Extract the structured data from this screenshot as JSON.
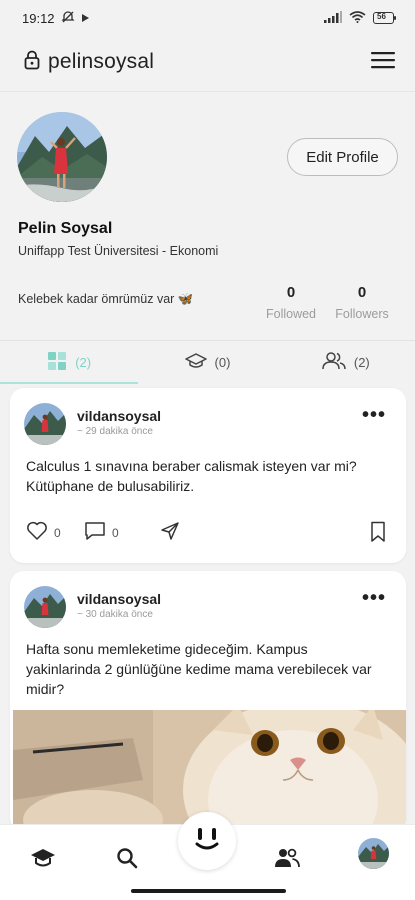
{
  "status_bar": {
    "time": "19:12",
    "battery": "56"
  },
  "header": {
    "username": "pelinsoysal"
  },
  "profile": {
    "edit_label": "Edit Profile",
    "name": "Pelin Soysal",
    "school": "Uniffapp Test Üniversitesi - Ekonomi",
    "bio": "Kelebek kadar ömrümüz var 🦋",
    "followed_count": "0",
    "followed_label": "Followed",
    "followers_count": "0",
    "followers_label": "Followers"
  },
  "tabs": [
    {
      "icon": "grid-icon",
      "count": "(2)",
      "active": true
    },
    {
      "icon": "graduation-cap-icon",
      "count": "(0)"
    },
    {
      "icon": "users-icon",
      "count": "(2)"
    }
  ],
  "posts": [
    {
      "user": "vildansoysal",
      "time": "~ 29 dakika önce",
      "text": "Calculus 1 sınavına beraber calismak isteyen var mi? Kütüphane de bulusabiliriz.",
      "likes": "0",
      "comments": "0"
    },
    {
      "user": "vildansoysal",
      "time": "~ 30 dakika önce",
      "text": "Hafta sonu memleketime gideceğim. Kampus yakinlarinda 2 günlüğüne kedime mama verebilecek var midir?"
    }
  ],
  "colors": {
    "accent": "#7fd3c6",
    "text": "#1c1c1c",
    "muted": "#9c9c9c"
  },
  "bottom_nav": [
    "graduation-cap-icon",
    "search-icon",
    "home-face-icon",
    "people-icon",
    "profile-avatar"
  ]
}
